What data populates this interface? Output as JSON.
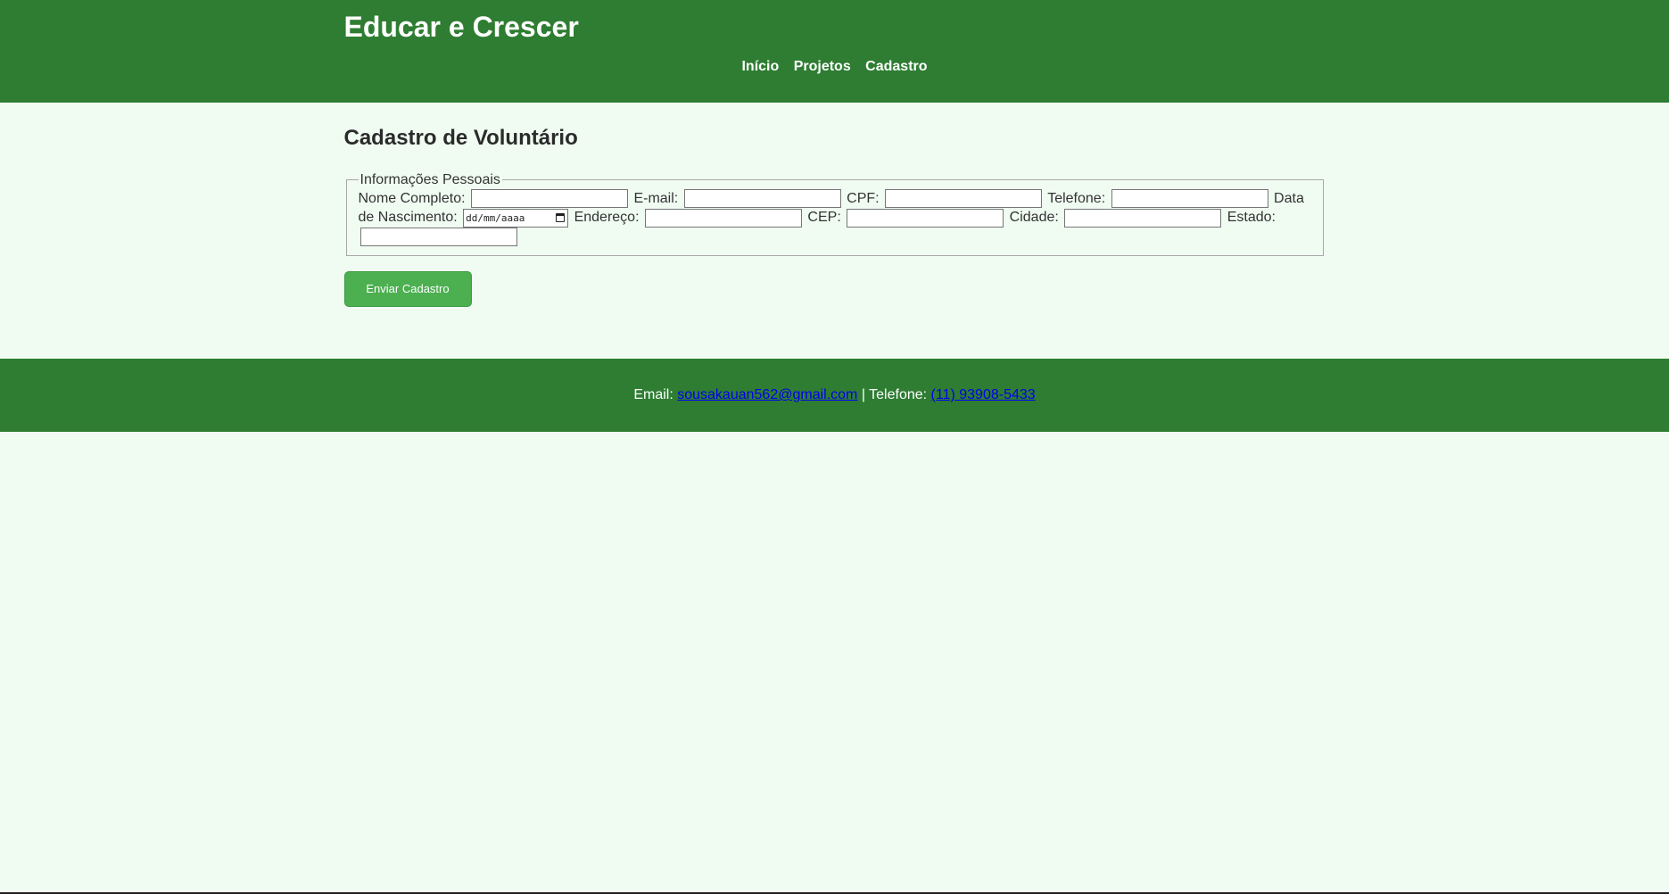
{
  "header": {
    "title": "Educar e Crescer",
    "nav": [
      "Início",
      "Projetos",
      "Cadastro"
    ]
  },
  "main": {
    "heading": "Cadastro de Voluntário",
    "fieldset": {
      "legend": "Informações Pessoais",
      "labels": {
        "nome": "Nome Completo:",
        "email": "E-mail:",
        "cpf": "CPF:",
        "telefone": "Telefone:",
        "nascimento": "Data de Nascimento:",
        "endereco": "Endereço:",
        "cep": "CEP:",
        "cidade": "Cidade:",
        "estado": "Estado:"
      },
      "values": {
        "nome": "",
        "email": "",
        "cpf": "",
        "telefone": "",
        "endereco": "",
        "cep": "",
        "cidade": "",
        "estado": ""
      },
      "date_placeholder": "dd/mm/aaaa"
    },
    "submit_label": "Enviar Cadastro"
  },
  "footer": {
    "email_label": "Email:",
    "email": "sousakauan562@gmail.com",
    "separator": "|",
    "phone_label": "Telefone:",
    "phone": "(11) 93908-5433"
  },
  "colors": {
    "header_bg": "#2e7d32",
    "page_bg": "#f0fcf2",
    "button_bg": "#4caf50",
    "link": "#0000ee"
  }
}
